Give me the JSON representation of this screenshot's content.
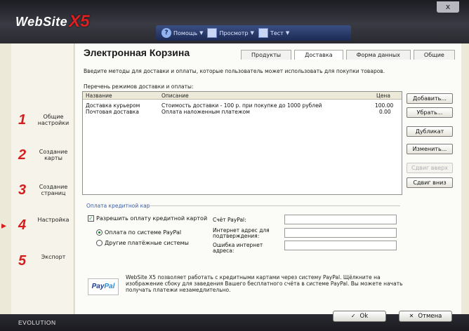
{
  "app": {
    "logo_text": "WebSite",
    "logo_version": "X5",
    "close_label": "x",
    "edition": "EVOLUTION"
  },
  "toolbar": {
    "help_label": "Помощь",
    "preview_label": "Просмотр",
    "test_label": "Тест"
  },
  "steps": [
    {
      "num": "1",
      "label": "Общие настройки"
    },
    {
      "num": "2",
      "label": "Создание карты"
    },
    {
      "num": "3",
      "label": "Создание страниц"
    },
    {
      "num": "4",
      "label": "Настройка"
    },
    {
      "num": "5",
      "label": "Экспорт"
    }
  ],
  "page": {
    "title": "Электронная Корзина",
    "tabs": [
      "Продукты",
      "Доставка",
      "Форма данных",
      "Общие"
    ],
    "active_tab": "Доставка",
    "description": "Введите методы для доставки и оплаты, которые пользователь может использовать для покупки товаров.",
    "list_label": "Перечень режимов доставки и оплаты:"
  },
  "table": {
    "columns": [
      "Название",
      "Описание",
      "Цена"
    ],
    "rows": [
      {
        "name": "Доставка курьером",
        "description": "Стоимость доставки - 100 р. при покупке до 1000 рублей",
        "price": "100.00"
      },
      {
        "name": "Почтовая доставка",
        "description": "Оплата наложенным платежом",
        "price": "0.00"
      }
    ]
  },
  "side_buttons": {
    "add": "Добавить...",
    "remove": "Убрать...",
    "duplicate": "Дубликат",
    "edit": "Изменить...",
    "move_up": "Сдвиг вверх",
    "move_down": "Сдвиг вниз"
  },
  "credit": {
    "section_label": "Оплата кредитной кар",
    "allow_label": "Разрешить оплату кредитной картой",
    "allow_checked": true,
    "option_paypal": "Оплата по системе PayPal",
    "option_other": "Другие платёжные системы",
    "selected_option": "paypal",
    "paypal_account_label": "Счёт PayPal:",
    "confirm_url_label": "Интернет адрес для подтверждения:",
    "error_url_label": "Ошибка интернет адреса:",
    "paypal_account_value": "",
    "confirm_url_value": "",
    "error_url_value": ""
  },
  "paypal": {
    "logo_part1": "Pay",
    "logo_part2": "Pal",
    "info": "WebSite X5 позволяет работать с кредитными картами через систему PayPal. Щёлкните на изображение сбоку для заведения Вашего бесплатного счёта в системе PayPal. Вы можете начать получать платежи незамедлительно."
  },
  "footer": {
    "ok_label": "Ok",
    "cancel_label": "Отмена"
  }
}
